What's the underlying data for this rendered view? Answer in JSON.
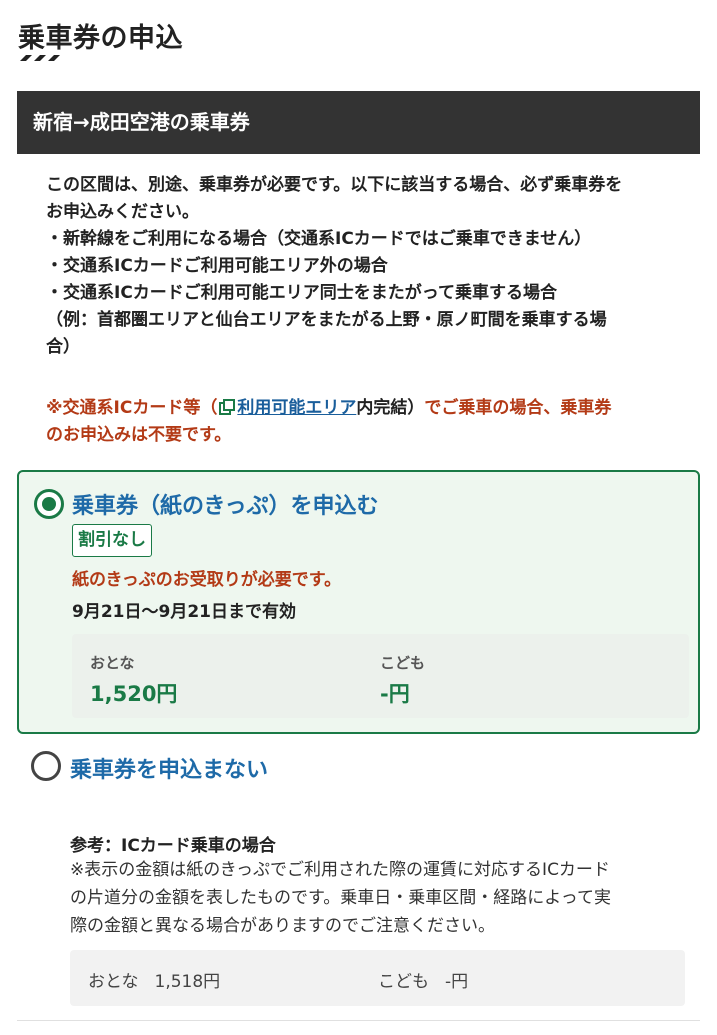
{
  "page": {
    "title": "乗車券の申込"
  },
  "section": {
    "header": "新宿→成田空港の乗車券"
  },
  "notice": {
    "lines": [
      "この区間は、別途、乗車券が必要です。以下に該当する場合、必ず乗車券を",
      "お申込みください。",
      "・新幹線をご利用になる場合（交通系ICカードではご乗車できません）",
      "・交通系ICカードご利用可能エリア外の場合",
      "・交通系ICカードご利用可能エリア同士をまたがって乗車する場合",
      "（例：首都圏エリアと仙台エリアをまたがる上野・原ノ町間を乗車する場",
      "合）"
    ]
  },
  "warning": {
    "prefix": "※交通系ICカード等（",
    "link_text": "利用可能エリア",
    "middle": "内完結）",
    "suffix": "でご乗車の場合、乗車券",
    "line2": "のお申込みは不要です。",
    "link_icon": "external-link-icon"
  },
  "options": {
    "selected": {
      "title": "乗車券（紙のきっぷ）を申込む",
      "badge": "割引なし",
      "paper_note": "紙のきっぷのお受取りが必要です。",
      "validity": "9月21日〜9月21日まで有効",
      "adult_label": "おとな",
      "adult_price": "1,520円",
      "child_label": "こども",
      "child_price": "-円",
      "checked": true
    },
    "unselected": {
      "title": "乗車券を申込まない",
      "checked": false
    }
  },
  "reference": {
    "title": "参考：ICカード乗車の場合",
    "lines": [
      "※表示の金額は紙のきっぷでご利用された際の運賃に対応するICカード",
      "の片道分の金額を表したものです。乗車日・乗車区間・経路によって実",
      "際の金額と異なる場合がありますのでご注意ください。"
    ],
    "adult_label": "おとな",
    "adult_price": "1,518円",
    "child_label": "こども",
    "child_price": "-円"
  },
  "colors": {
    "accent_green": "#1a7a46",
    "link_blue": "#1e6aa8",
    "warning_red": "#b33a16",
    "header_dark": "#333333"
  }
}
